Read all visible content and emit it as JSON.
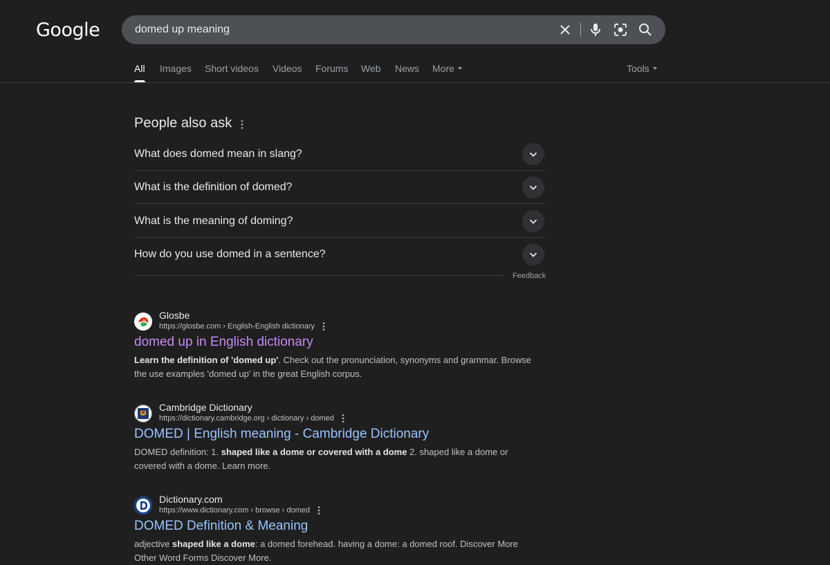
{
  "logo": "Google",
  "search": {
    "query": "domed up meaning"
  },
  "tabs": [
    "All",
    "Images",
    "Short videos",
    "Videos",
    "Forums",
    "Web",
    "News",
    "More"
  ],
  "tools_label": "Tools",
  "paa": {
    "title": "People also ask",
    "questions": [
      "What does domed mean in slang?",
      "What is the definition of domed?",
      "What is the meaning of doming?",
      "How do you use domed in a sentence?"
    ],
    "feedback": "Feedback"
  },
  "results": [
    {
      "site": "Glosbe",
      "url": "https://glosbe.com › English-English dictionary",
      "title": "domed up in English dictionary",
      "snippet": [
        "Learn the definition of 'domed up'",
        ". Check out the pronunciation, synonyms and grammar. Browse the use examples 'domed up' in the great English corpus."
      ]
    },
    {
      "site": "Cambridge Dictionary",
      "url": "https://dictionary.cambridge.org › dictionary › domed",
      "title": "DOMED | English meaning - Cambridge Dictionary",
      "snippet": [
        "DOMED definition: 1. ",
        "shaped like a dome or covered with a dome",
        " 2. shaped like a dome or covered with a dome. Learn more."
      ]
    },
    {
      "site": "Dictionary.com",
      "url": "https://www.dictionary.com › browse › domed",
      "title": "DOMED Definition & Meaning",
      "snippet": [
        "adjective ",
        "shaped like a dome",
        ": a domed forehead. having a dome: a domed roof. Discover More Other Word Forms Discover More."
      ]
    }
  ],
  "colors": {
    "background": "#1f1f1f",
    "visited_link": "#c58af9",
    "link": "#99c3ff"
  }
}
